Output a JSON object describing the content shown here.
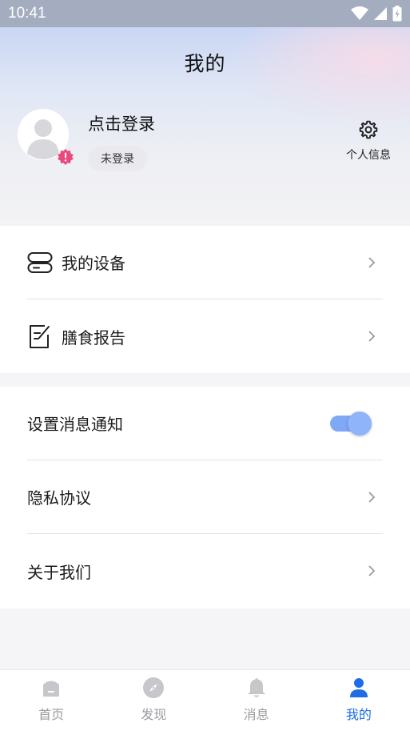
{
  "status_bar": {
    "time": "10:41"
  },
  "header": {
    "title": "我的",
    "login_prompt": "点击登录",
    "login_status": "未登录",
    "settings_label": "个人信息"
  },
  "menu_group_1": [
    {
      "label": "我的设备",
      "icon": "device-icon"
    },
    {
      "label": "膳食报告",
      "icon": "report-icon"
    }
  ],
  "menu_group_2": [
    {
      "label": "设置消息通知",
      "control": "toggle",
      "toggle_on": true
    },
    {
      "label": "隐私协议",
      "control": "chevron"
    },
    {
      "label": "关于我们",
      "control": "chevron"
    }
  ],
  "tabbar": [
    {
      "label": "首页",
      "icon": "home-icon",
      "active": false
    },
    {
      "label": "发现",
      "icon": "compass-icon",
      "active": false
    },
    {
      "label": "消息",
      "icon": "bell-icon",
      "active": false
    },
    {
      "label": "我的",
      "icon": "person-icon",
      "active": true
    }
  ],
  "colors": {
    "accent": "#1e6de6",
    "toggle_on": "#7fa8f5",
    "badge": "#e84a7f",
    "tab_inactive": "#9a9aa0"
  }
}
